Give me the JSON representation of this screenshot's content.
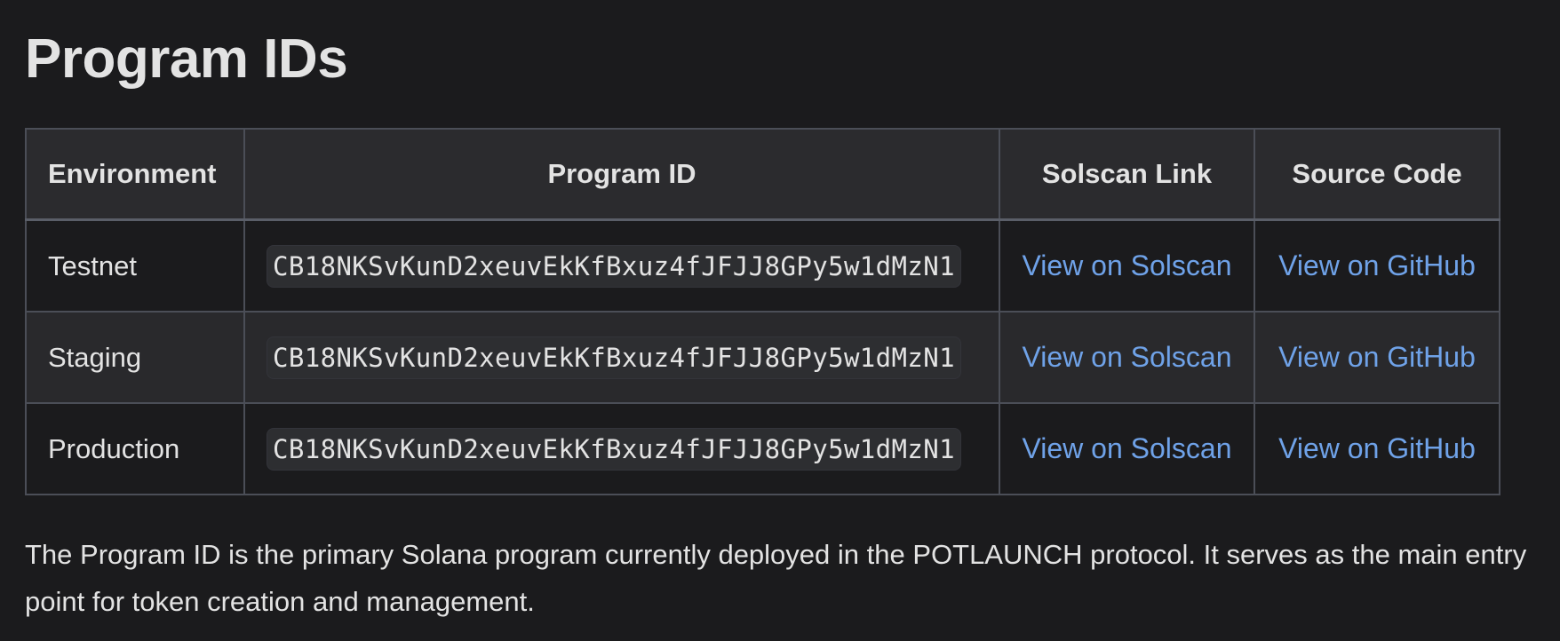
{
  "heading": "Program IDs",
  "table": {
    "headers": [
      "Environment",
      "Program ID",
      "Solscan Link",
      "Source Code"
    ],
    "rows": [
      {
        "environment": "Testnet",
        "program_id": "CB18NKSvKunD2xeuvEkKfBxuz4fJFJJ8GPy5w1dMzN1",
        "solscan": "View on Solscan",
        "source": "View on GitHub"
      },
      {
        "environment": "Staging",
        "program_id": "CB18NKSvKunD2xeuvEkKfBxuz4fJFJJ8GPy5w1dMzN1",
        "solscan": "View on Solscan",
        "source": "View on GitHub"
      },
      {
        "environment": "Production",
        "program_id": "CB18NKSvKunD2xeuvEkKfBxuz4fJFJJ8GPy5w1dMzN1",
        "solscan": "View on Solscan",
        "source": "View on GitHub"
      }
    ]
  },
  "description": "The Program ID is the primary Solana program currently deployed in the POTLAUNCH protocol. It serves as the main entry point for token creation and management.",
  "colors": {
    "background": "#1b1b1d",
    "link": "#6fa2e8",
    "text": "#e3e3e3"
  }
}
